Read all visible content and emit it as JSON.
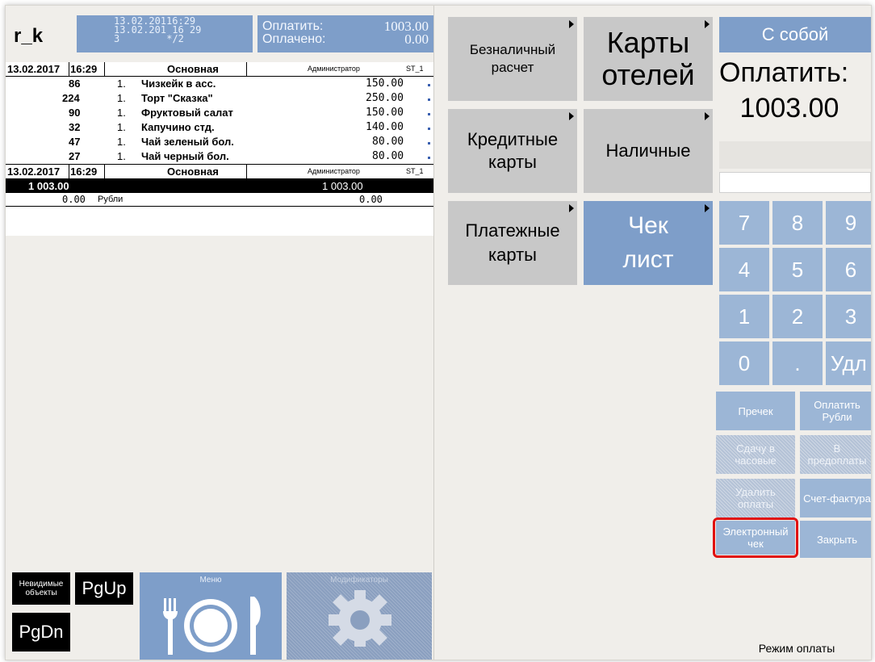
{
  "app": {
    "logo": "r_k"
  },
  "header": {
    "line1": "13.02.20116:29",
    "line2": "13.02.201 16 29",
    "line3_a": "3",
    "line3_b": "*/2",
    "pay_label": "Оплатить:",
    "pay_value": "1003.00",
    "paid_label": "Оплачено:",
    "paid_value": "0.00"
  },
  "receipt": {
    "head": {
      "datetime": "13.02.2017",
      "time": "16:29",
      "section": "Основная",
      "user": "Администратор",
      "station": "ST_1"
    },
    "items": [
      {
        "code": "86",
        "qty": "1.",
        "name": "Чизкейк в асс.",
        "price": "150.00"
      },
      {
        "code": "224",
        "qty": "1.",
        "name": "Торт \"Сказка\"",
        "price": "250.00"
      },
      {
        "code": "90",
        "qty": "1.",
        "name": "Фруктовый салат",
        "price": "150.00"
      },
      {
        "code": "32",
        "qty": "1.",
        "name": "Капучино стд.",
        "price": "140.00"
      },
      {
        "code": "47",
        "qty": "1.",
        "name": "Чай зеленый бол.",
        "price": "80.00"
      },
      {
        "code": "27",
        "qty": "1.",
        "name": "Чай черный бол.",
        "price": "80.00"
      }
    ],
    "foot": {
      "datetime": "13.02.2017",
      "time": "16:29",
      "section": "Основная",
      "user": "Администратор",
      "station": "ST_1"
    },
    "total_left": "1 003.00",
    "total_right": "1 003.00",
    "paid_left": "0.00",
    "paid_currency": "Рубли",
    "paid_right": "0.00"
  },
  "bottom": {
    "invisible": "Невидимые объекты",
    "pgup": "PgUp",
    "pgdn": "PgDn",
    "menu": "Меню",
    "modifiers": "Модификаторы"
  },
  "pay_types": {
    "cashless": "Безналичный расчет",
    "hotel_cards": "Карты отелей",
    "credit_cards": "Кредитные карты",
    "cash": "Наличные",
    "payment_cards": "Платежные карты",
    "check_list": "Чек лист"
  },
  "right": {
    "takeaway": "С собой",
    "pay_label": "Оплатить:",
    "pay_value": "1003.00",
    "keys": [
      "7",
      "8",
      "9",
      "4",
      "5",
      "6",
      "1",
      "2",
      "3",
      "0",
      ".",
      "Удл"
    ],
    "precheck": "Пречек",
    "pay_rub": "Оплатить Рубли",
    "change_hours": "Сдачу в часовые",
    "prepay": "В предоплаты",
    "delete_pay": "Удалить оплаты",
    "invoice": "Счет-фактура",
    "e_receipt": "Электронный чек",
    "close": "Закрыть",
    "mode": "Режим оплаты"
  },
  "colors": {
    "accent_blue": "#7e9ec9",
    "highlight_red": "#e01010"
  }
}
